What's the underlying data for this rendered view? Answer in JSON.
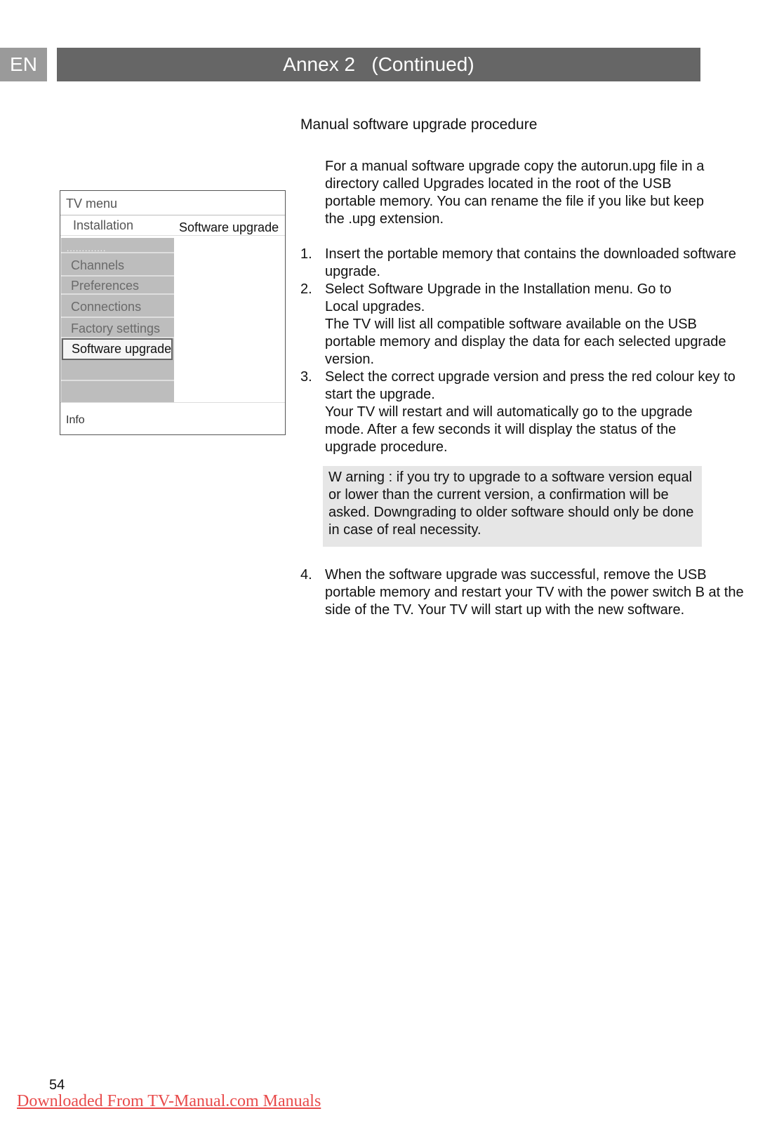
{
  "header": {
    "language_badge": "EN",
    "title": "Annex 2   (Continued)"
  },
  "tv_menu": {
    "title": "TV menu",
    "current_menu": "Installation",
    "submenu_title": "Software upgrade",
    "dots": ".............",
    "items": [
      "Channels",
      "Preferences",
      "Connections",
      "Factory settings"
    ],
    "selected_item": "Software upgrade",
    "info_label": "Info"
  },
  "section": {
    "title": "Manual software upgrade procedure",
    "intro": "For a manual software upgrade copy the  autorun.upg  file in a directory called  Upgrades  located in the root of the USB portable memory. You can rename the file if you like but keep the .upg extension."
  },
  "steps": [
    {
      "num": "1.",
      "text": "Insert the portable memory that contains the downloaded software upgrade."
    },
    {
      "num": "2.",
      "text": "Select Software Upgrade  in the Installation menu. Go to Local upgrades.",
      "extra": "The TV will list all compatible software available on the USB portable memory and display the data for each selected upgrade version."
    },
    {
      "num": "3.",
      "text": "Select the correct upgrade version and press the red colour key to start the upgrade.",
      "extra": "Your TV will restart and will automatically go to the upgrade mode. After a few seconds it will display the status of the upgrade procedure."
    },
    {
      "num": "4.",
      "text": "When the software upgrade was successful, remove the USB portable memory and restart your TV with the power switch B   at the side of the TV. Your TV will start up with the new software."
    }
  ],
  "warning": "W arning : if you try to upgrade to a software version equal or lower than the current version, a confirmation will be asked. Downgrading to older software should only be done in case of real necessity.",
  "footer": {
    "page_number": "54",
    "link_text": "Downloaded From TV-Manual.com Manuals"
  },
  "colors": {
    "header_bar": "#666666",
    "language_badge": "#9a9a9a",
    "menu_column": "#bdbdbd",
    "warning_bg": "#e6e6e6",
    "footer_link": "#e84a4a"
  }
}
